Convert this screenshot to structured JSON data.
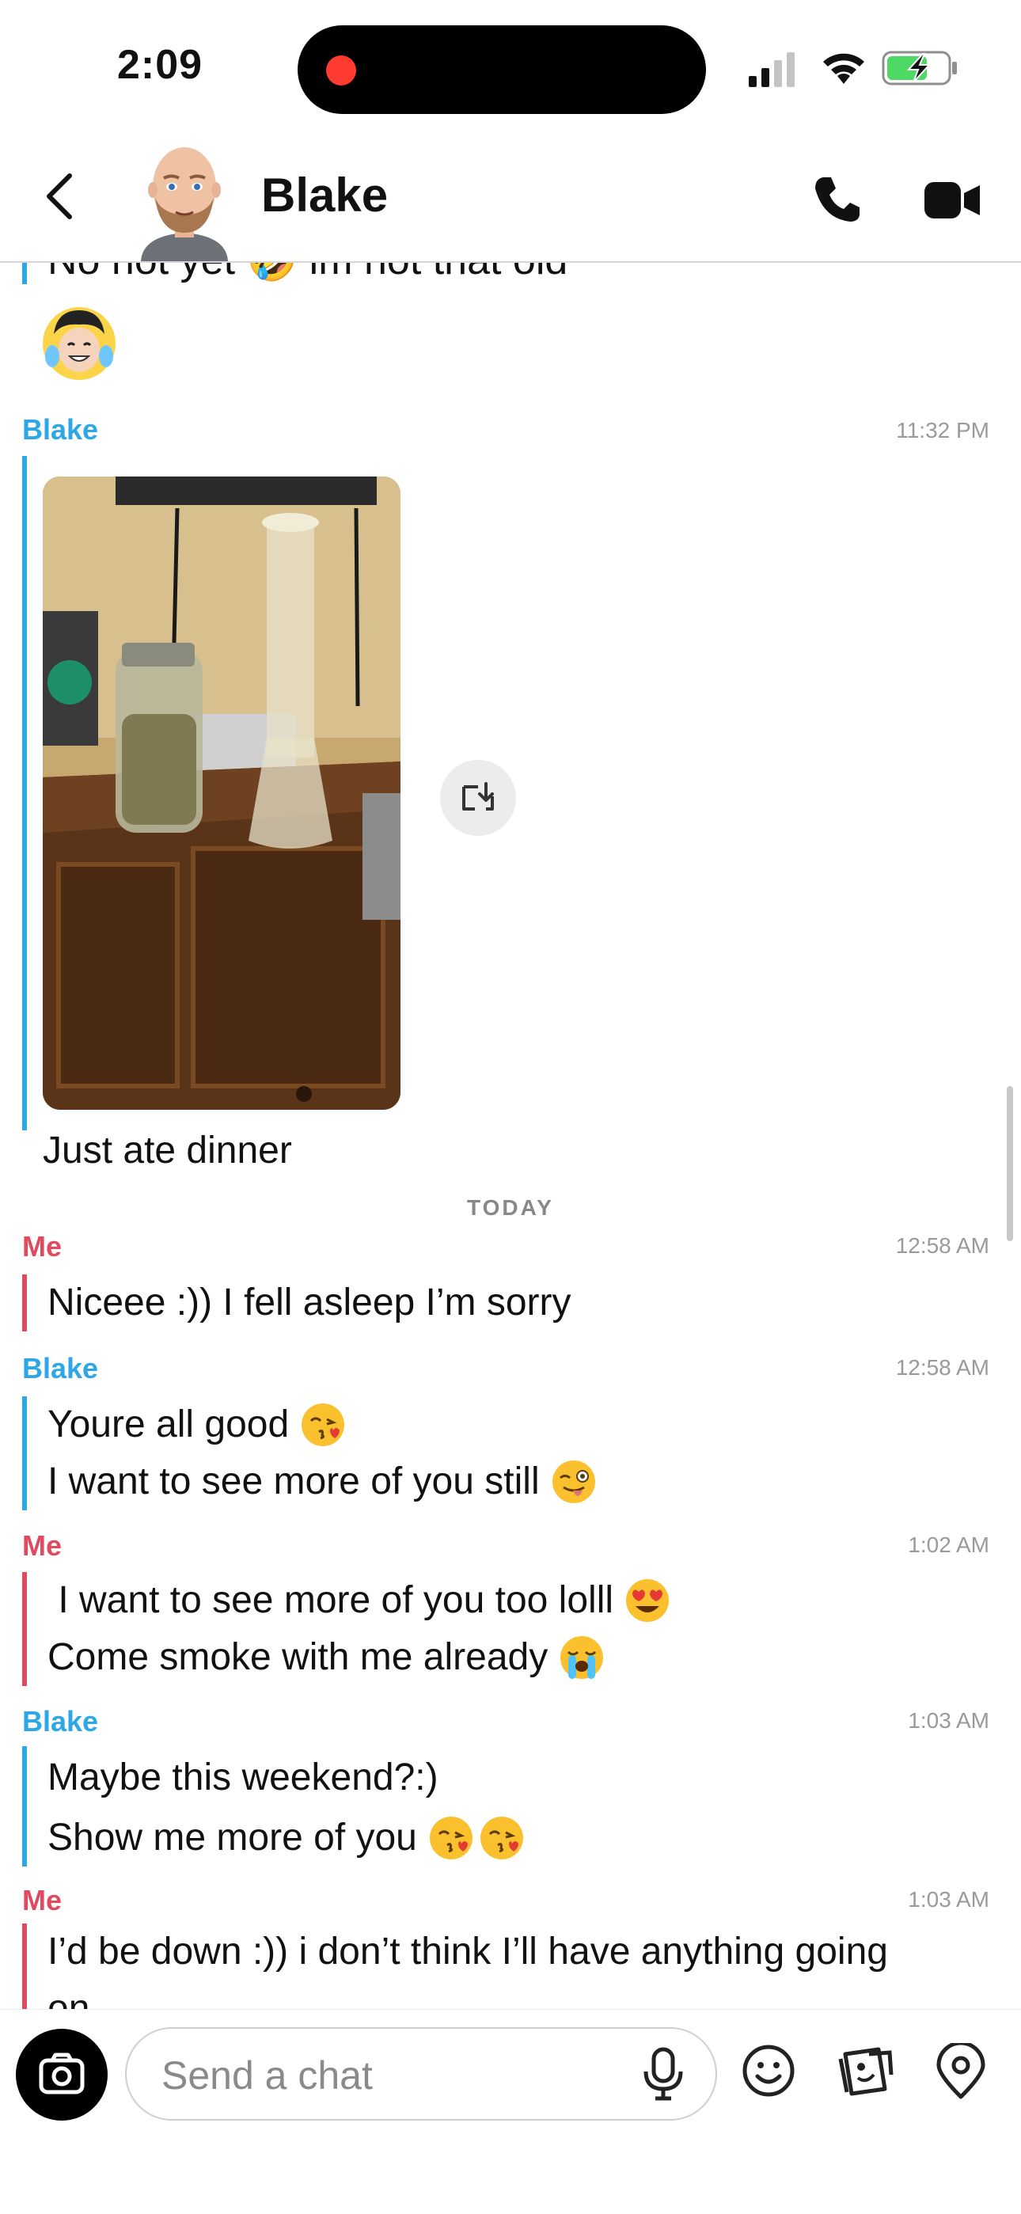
{
  "status_bar": {
    "time": "2:09"
  },
  "header": {
    "contact_name": "Blake"
  },
  "chat": {
    "cutoff_text": "No not yet 🤣 im not that old",
    "today_label": "TODAY",
    "groups": [
      {
        "sender": "Blake",
        "time": "11:32 PM",
        "lines": [
          "Just ate dinner"
        ],
        "has_photo": true
      },
      {
        "sender": "Me",
        "time": "12:58 AM",
        "lines": [
          "Niceee :)) I fell asleep I’m sorry"
        ]
      },
      {
        "sender": "Blake",
        "time": "12:58 AM",
        "lines": [
          "Youre all good",
          "I want to see more of you still"
        ]
      },
      {
        "sender": "Me",
        "time": "1:02 AM",
        "lines": [
          " I want to see more of you too lolll",
          "Come smoke with me already"
        ]
      },
      {
        "sender": "Blake",
        "time": "1:03 AM",
        "lines": [
          "Maybe this weekend?:)",
          "Show me more of you"
        ]
      },
      {
        "sender": "Me",
        "time": "1:03 AM",
        "lines": [
          "I’d be down :)) i don’t think I’ll have anything going",
          "on"
        ]
      }
    ]
  },
  "composer": {
    "placeholder": "Send a chat"
  },
  "colors": {
    "blake": "#2ea7e6",
    "me": "#e04a5f"
  }
}
